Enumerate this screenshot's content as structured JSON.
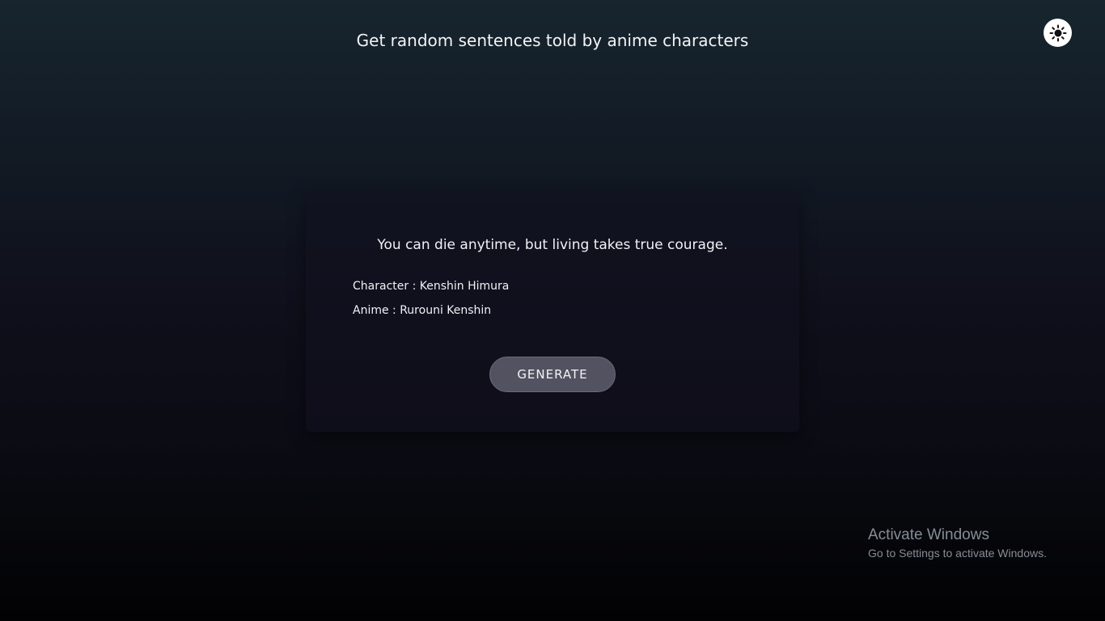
{
  "header": {
    "title": "Get random sentences told by anime characters",
    "theme_toggle_icon": "sun-icon"
  },
  "card": {
    "quote": "You can die anytime, but living takes true courage.",
    "character_line": "Character : Kenshin Himura",
    "anime_line": "Anime : Rurouni Kenshin",
    "generate_label": "GENERATE"
  },
  "watermark": {
    "title": "Activate Windows",
    "subtitle": "Go to Settings to activate Windows."
  },
  "colors": {
    "background_top": "#17252e",
    "background_bottom": "#020203",
    "button_bg": "#535260",
    "text": "#ffffff"
  }
}
